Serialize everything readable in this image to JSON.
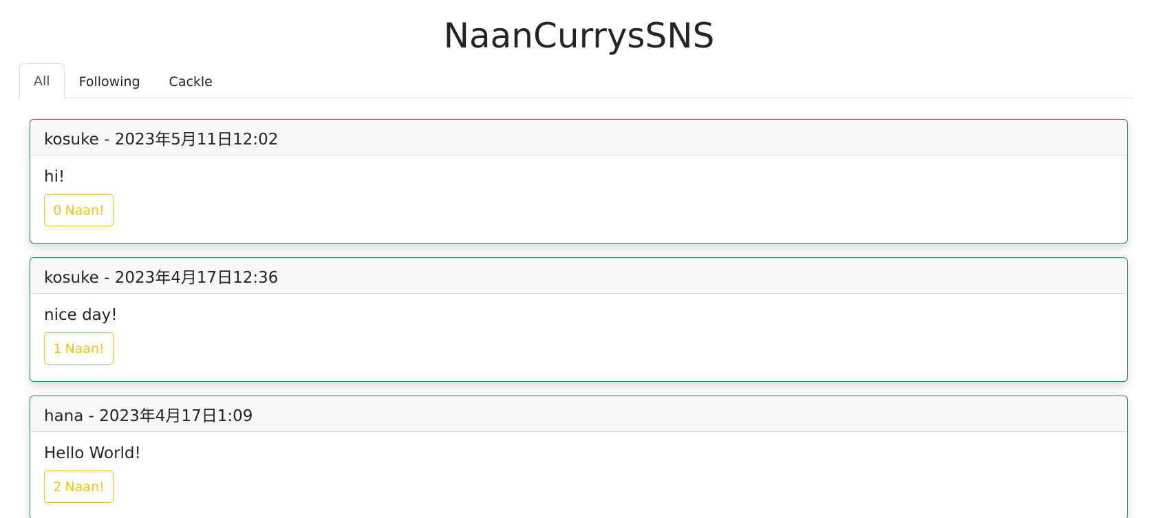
{
  "app": {
    "title": "NaanCurrysSNS"
  },
  "tabs": [
    {
      "label": "All",
      "active": true
    },
    {
      "label": "Following",
      "active": false
    },
    {
      "label": "Cackle",
      "active": false
    }
  ],
  "posts": [
    {
      "header": "kosuke - 2023年5月11日12:02",
      "text": "hi!",
      "naan_count": "0",
      "naan_label": "Naan!"
    },
    {
      "header": "kosuke - 2023年4月17日12:36",
      "text": "nice day!",
      "naan_count": "1",
      "naan_label": "Naan!"
    },
    {
      "header": "hana - 2023年4月17日1:09",
      "text": "Hello World!",
      "naan_count": "2",
      "naan_label": "Naan!"
    }
  ],
  "colors": {
    "card_border": "#198754",
    "naan_accent": "#ffc107",
    "header_bg": "#f7f7f7"
  }
}
